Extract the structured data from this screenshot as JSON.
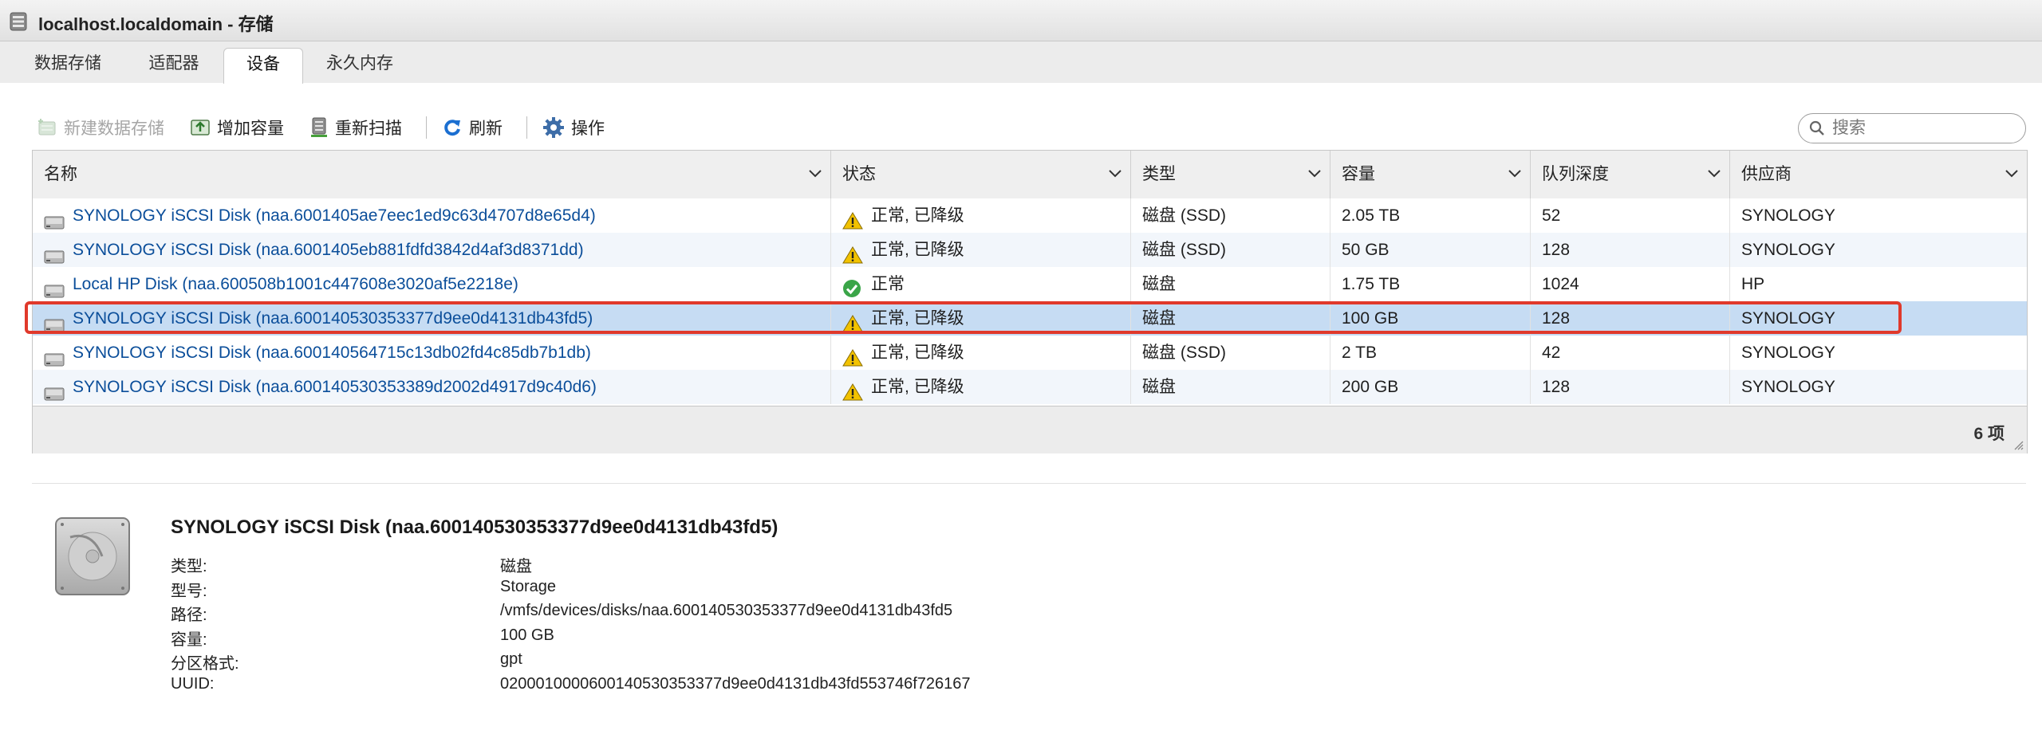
{
  "window": {
    "title": "localhost.localdomain - 存储"
  },
  "tabs": [
    {
      "label": "数据存储"
    },
    {
      "label": "适配器"
    },
    {
      "label": "设备"
    },
    {
      "label": "永久内存"
    }
  ],
  "toolbar": {
    "new_datastore": "新建数据存储",
    "increase_capacity": "增加容量",
    "rescan": "重新扫描",
    "refresh": "刷新",
    "actions": "操作"
  },
  "search": {
    "placeholder": "搜索"
  },
  "table": {
    "columns": [
      "名称",
      "状态",
      "类型",
      "容量",
      "队列深度",
      "供应商"
    ],
    "rows": [
      {
        "name": "SYNOLOGY iSCSI Disk (naa.6001405ae7eec1ed9c63d4707d8e65d4)",
        "status": "正常, 已降级",
        "status_kind": "warning",
        "type": "磁盘 (SSD)",
        "capacity": "2.05 TB",
        "queue_depth": "52",
        "vendor": "SYNOLOGY"
      },
      {
        "name": "SYNOLOGY iSCSI Disk (naa.6001405eb881fdfd3842d4af3d8371dd)",
        "status": "正常, 已降级",
        "status_kind": "warning",
        "type": "磁盘 (SSD)",
        "capacity": "50 GB",
        "queue_depth": "128",
        "vendor": "SYNOLOGY"
      },
      {
        "name": "Local HP Disk (naa.600508b1001c447608e3020af5e2218e)",
        "status": "正常",
        "status_kind": "ok",
        "type": "磁盘",
        "capacity": "1.75 TB",
        "queue_depth": "1024",
        "vendor": "HP"
      },
      {
        "name": "SYNOLOGY iSCSI Disk (naa.600140530353377d9ee0d4131db43fd5)",
        "status": "正常, 已降级",
        "status_kind": "warning",
        "type": "磁盘",
        "capacity": "100 GB",
        "queue_depth": "128",
        "vendor": "SYNOLOGY"
      },
      {
        "name": "SYNOLOGY iSCSI Disk (naa.600140564715c13db02fd4c85db7b1db)",
        "status": "正常, 已降级",
        "status_kind": "warning",
        "type": "磁盘 (SSD)",
        "capacity": "2 TB",
        "queue_depth": "42",
        "vendor": "SYNOLOGY"
      },
      {
        "name": "SYNOLOGY iSCSI Disk (naa.600140530353389d2002d4917d9c40d6)",
        "status": "正常, 已降级",
        "status_kind": "warning",
        "type": "磁盘",
        "capacity": "200 GB",
        "queue_depth": "128",
        "vendor": "SYNOLOGY"
      }
    ],
    "item_count": "6 项"
  },
  "detail": {
    "title": "SYNOLOGY iSCSI Disk (naa.600140530353377d9ee0d4131db43fd5)",
    "fields": [
      {
        "label": "类型:",
        "value": "磁盘"
      },
      {
        "label": "型号:",
        "value": "Storage"
      },
      {
        "label": "路径:",
        "value": "/vmfs/devices/disks/naa.600140530353377d9ee0d4131db43fd5"
      },
      {
        "label": "容量:",
        "value": "100 GB"
      },
      {
        "label": "分区格式:",
        "value": "gpt"
      },
      {
        "label": "UUID:",
        "value": "0200010000600140530353377d9ee0d4131db43fd553746f726167"
      }
    ]
  },
  "colors": {
    "link": "#0b4e9a",
    "selected_row": "#c6dcf3",
    "highlight_border": "#e0392b",
    "warning": "#f2c200",
    "ok": "#3aa548"
  },
  "icons": [
    "storage-icon",
    "new-datastore-icon",
    "increase-capacity-icon",
    "rescan-icon",
    "refresh-icon",
    "gear-icon",
    "search-icon",
    "disk-icon",
    "warning-icon",
    "ok-icon",
    "hard-drive-icon"
  ]
}
